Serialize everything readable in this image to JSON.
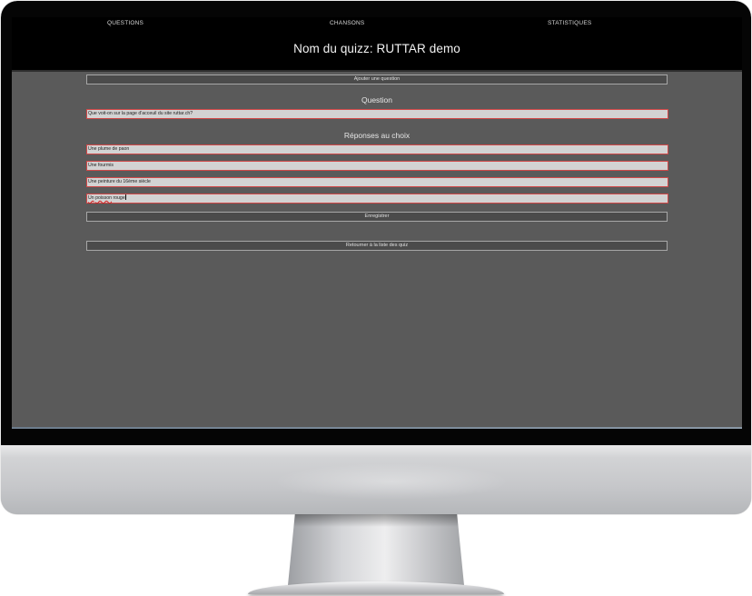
{
  "nav": {
    "questions": "QUESTIONS",
    "chansons": "CHANSONS",
    "statistiques": "STATISTIQUES"
  },
  "header": {
    "quiz_title": "Nom du quizz: RUTTAR demo"
  },
  "buttons": {
    "add_question": "Ajouter une question",
    "save": "Enregistrer",
    "back_to_list": "Retourner à la liste des quiz"
  },
  "question_section": {
    "heading": "Question",
    "value": "Que voit-on sur la page d'acceuil du site ruttar.ch?"
  },
  "answers_section": {
    "heading": "Réponses au choix",
    "answers": [
      "Une plume de paon",
      "Une fourmis",
      "Une peinture du 16ème siècle"
    ],
    "answer4_word1": "Un",
    "answer4_word2": "poisson",
    "answer4_word3": "rouge"
  },
  "colors": {
    "screen_bg": "#5a5a5a",
    "header_bg": "#000000",
    "field_bg": "#d3d3d3",
    "field_border": "#d04848"
  }
}
